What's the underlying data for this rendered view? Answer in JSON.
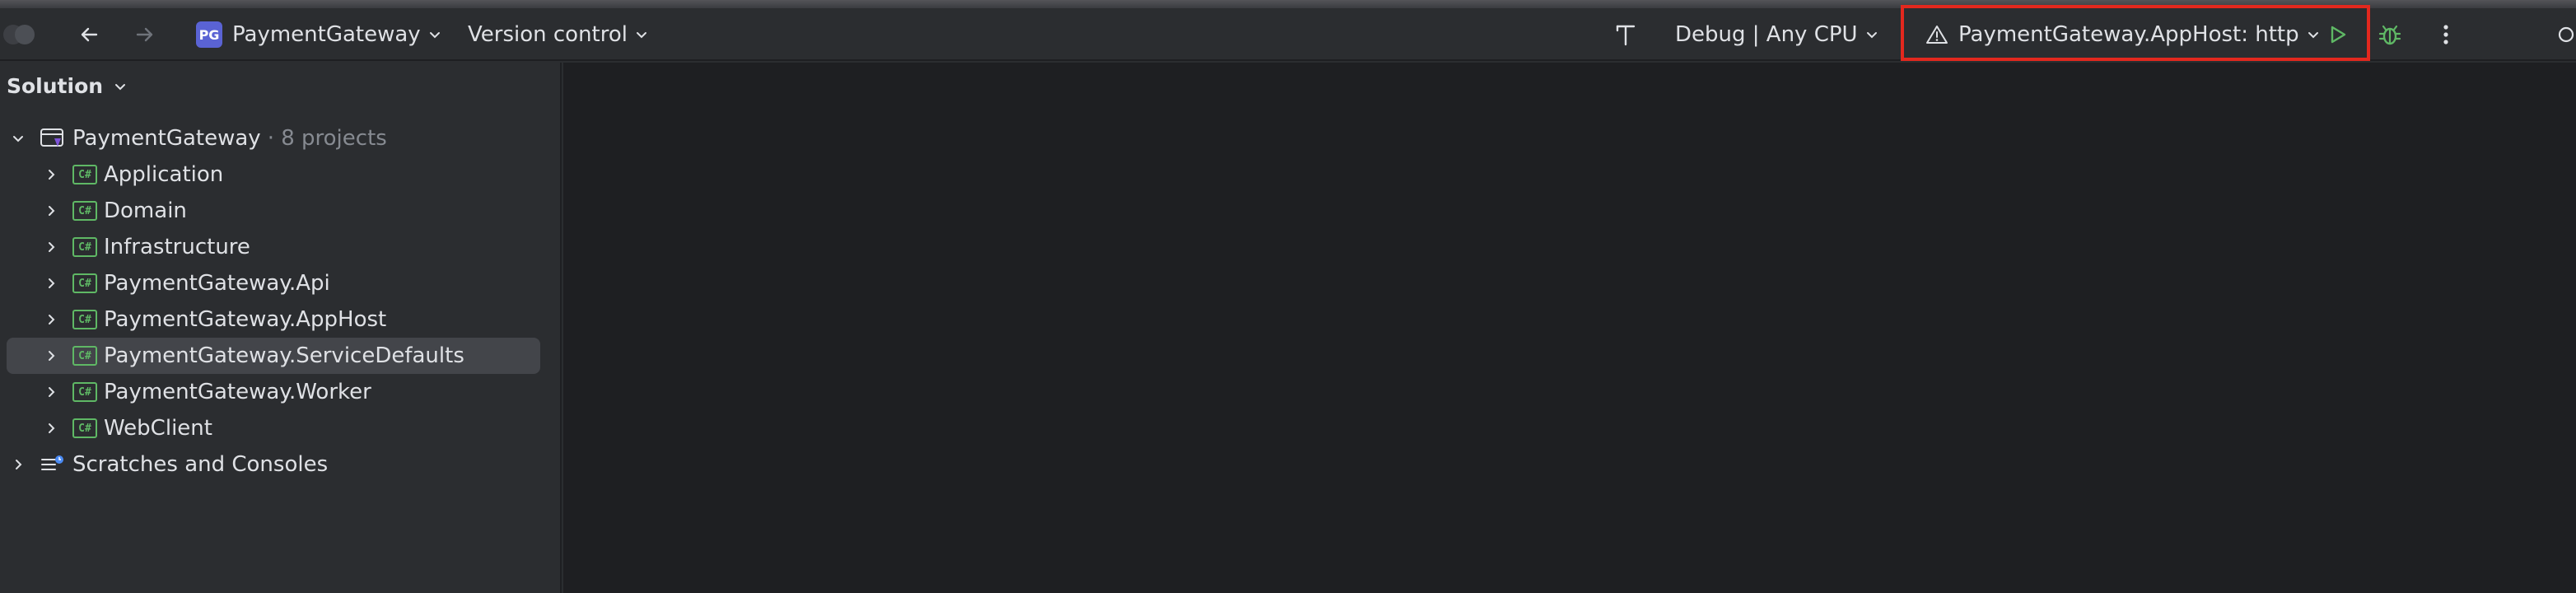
{
  "toolbar": {
    "project_badge": "PG",
    "project_name": "PaymentGateway",
    "version_control": "Version control",
    "build_config": "Debug | Any CPU",
    "run_config": "PaymentGateway.AppHost: http"
  },
  "solution_panel": {
    "title": "Solution",
    "root": {
      "name": "PaymentGateway",
      "suffix": "· 8 projects"
    },
    "projects": [
      {
        "name": "Application",
        "icon": "C#"
      },
      {
        "name": "Domain",
        "icon": "C#"
      },
      {
        "name": "Infrastructure",
        "icon": "C#"
      },
      {
        "name": "PaymentGateway.Api",
        "icon": "C#"
      },
      {
        "name": "PaymentGateway.AppHost",
        "icon": "C#"
      },
      {
        "name": "PaymentGateway.ServiceDefaults",
        "icon": "C#"
      },
      {
        "name": "PaymentGateway.Worker",
        "icon": "C#"
      },
      {
        "name": "WebClient",
        "icon": "C#"
      }
    ],
    "scratches": "Scratches and Consoles",
    "selected_project": "PaymentGateway.ServiceDefaults"
  },
  "colors": {
    "background": "#2b2d30",
    "editor_background": "#1e1f22",
    "selection": "#43454a",
    "csharp_icon": "#5fb865",
    "run_green": "#5fb865",
    "highlight_box": "#e3281e",
    "project_badge": "#5a63d4"
  },
  "icons": {
    "back": "arrow-left-icon",
    "forward": "arrow-right-icon",
    "build": "hammer-icon",
    "run_config": "warning-triangle-icon",
    "run": "play-icon",
    "debug": "bug-icon",
    "more": "kebab-menu-icon"
  }
}
